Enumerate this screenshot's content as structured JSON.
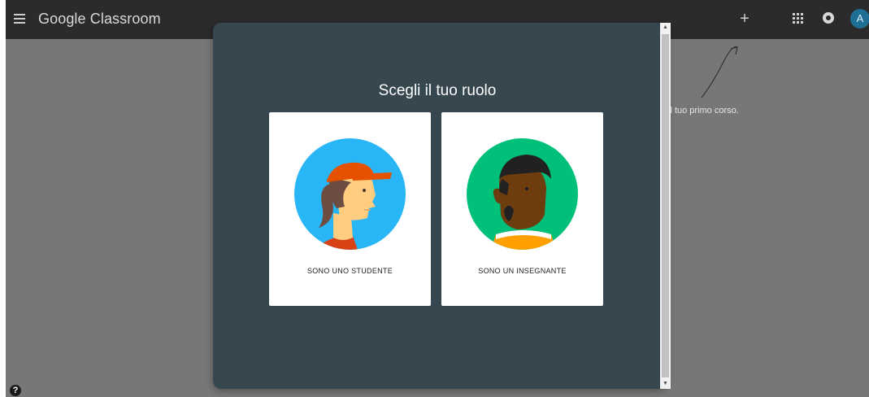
{
  "app": {
    "title": "Google Classroom"
  },
  "header": {
    "add_label": "+",
    "avatar_letter": "A"
  },
  "background": {
    "hint_text": "il tuo primo corso."
  },
  "dialog": {
    "title": "Scegli il tuo ruolo",
    "roles": [
      {
        "label": "SONO UNO STUDENTE"
      },
      {
        "label": "SONO UN INSEGNANTE"
      }
    ]
  },
  "help": {
    "label": "?"
  },
  "colors": {
    "topbar": "#2b2b2b",
    "dialog": "#37474f",
    "avatar": "#1f6f95",
    "student_bg": "#29b6f6",
    "teacher_bg": "#00c07a"
  },
  "icons": [
    "menu-icon",
    "plus-icon",
    "apps-grid-icon",
    "notifications-icon",
    "help-icon"
  ]
}
